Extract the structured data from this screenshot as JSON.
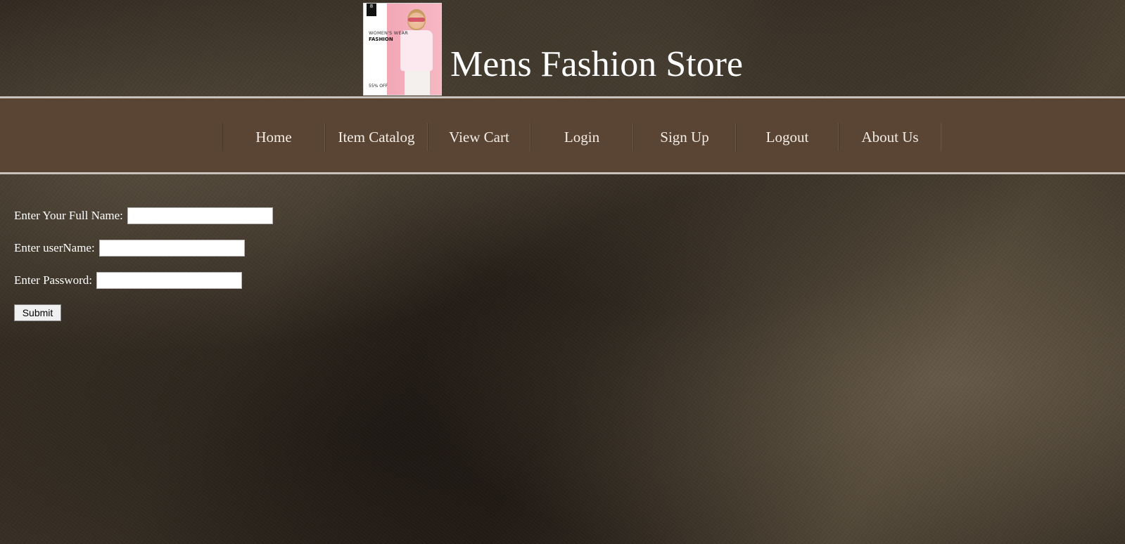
{
  "header": {
    "title": "Mens Fashion Store",
    "logo": {
      "badge": "8",
      "line1": "WOMEN'S WEAR",
      "line2": "FASHION",
      "line3": "55% OFF"
    }
  },
  "nav": {
    "items": [
      {
        "label": "Home"
      },
      {
        "label": "Item Catalog"
      },
      {
        "label": "View Cart"
      },
      {
        "label": "Login"
      },
      {
        "label": "Sign Up"
      },
      {
        "label": "Logout"
      },
      {
        "label": "About Us"
      }
    ]
  },
  "form": {
    "fullname_label": "Enter Your Full Name:",
    "fullname_value": "",
    "username_label": "Enter userName:",
    "username_value": "",
    "password_label": "Enter Password:",
    "password_value": "",
    "submit_label": "Submit"
  },
  "colors": {
    "navbar": "#5a4534",
    "nav_border": "#c9c2bb",
    "text": "#ffffff"
  }
}
